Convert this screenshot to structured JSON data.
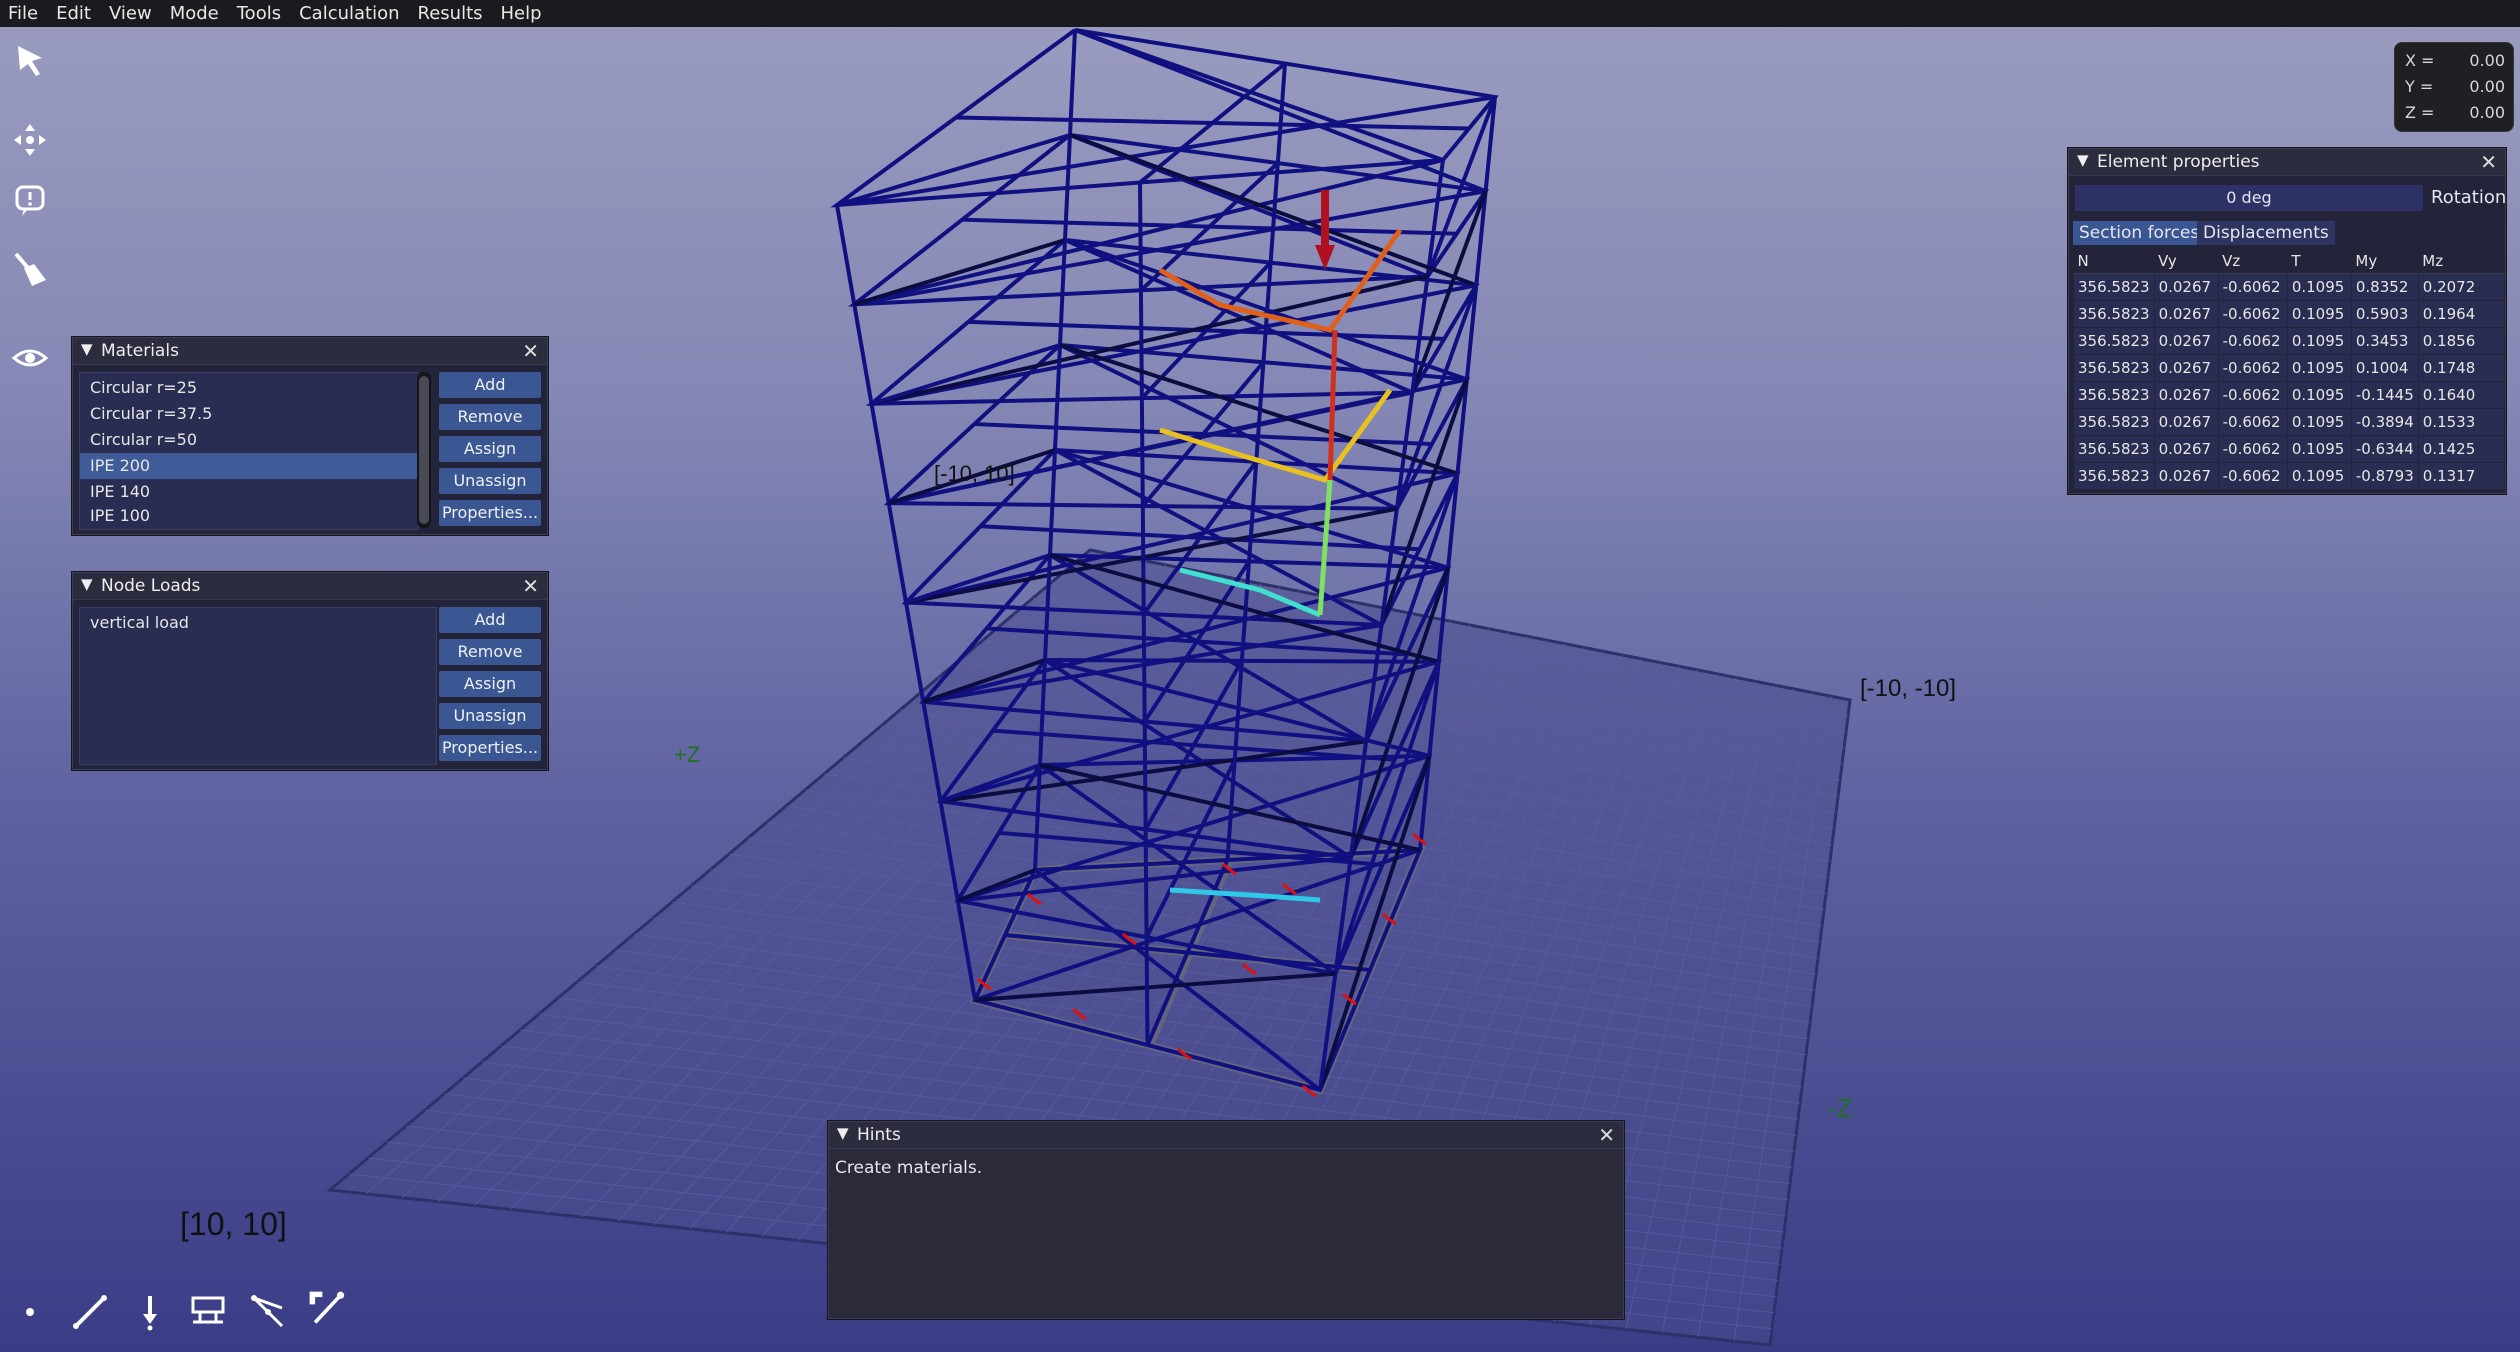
{
  "menu": [
    "File",
    "Edit",
    "View",
    "Mode",
    "Tools",
    "Calculation",
    "Results",
    "Help"
  ],
  "coords": {
    "x_label": "X =",
    "y_label": "Y =",
    "z_label": "Z =",
    "x": "0.00",
    "y": "0.00",
    "z": "0.00"
  },
  "viewport": {
    "corner_a": "[-10, 10]",
    "corner_b": "[-10, -10]",
    "corner_c": "[10, 10]",
    "axis_pos": "+Z",
    "axis_neg": "-Z"
  },
  "materials": {
    "title": "Materials",
    "items": [
      "Circular r=25",
      "Circular r=37.5",
      "Circular r=50",
      "IPE 200",
      "IPE 140",
      "IPE 100"
    ],
    "selected_index": 3,
    "buttons": {
      "add": "Add",
      "remove": "Remove",
      "assign": "Assign",
      "unassign": "Unassign",
      "properties": "Properties..."
    }
  },
  "node_loads": {
    "title": "Node Loads",
    "items": [
      "vertical load"
    ],
    "buttons": {
      "add": "Add",
      "remove": "Remove",
      "assign": "Assign",
      "unassign": "Unassign",
      "properties": "Properties..."
    }
  },
  "element_properties": {
    "title": "Element properties",
    "rotation_value": "0 deg",
    "rotation_label": "Rotation",
    "tabs": [
      "Section forces",
      "Displacements"
    ],
    "columns": [
      "N",
      "Vy",
      "Vz",
      "T",
      "My",
      "Mz"
    ],
    "rows": [
      [
        "356.5823",
        "0.0267",
        "-0.6062",
        "0.1095",
        "0.8352",
        "0.2072"
      ],
      [
        "356.5823",
        "0.0267",
        "-0.6062",
        "0.1095",
        "0.5903",
        "0.1964"
      ],
      [
        "356.5823",
        "0.0267",
        "-0.6062",
        "0.1095",
        "0.3453",
        "0.1856"
      ],
      [
        "356.5823",
        "0.0267",
        "-0.6062",
        "0.1095",
        "0.1004",
        "0.1748"
      ],
      [
        "356.5823",
        "0.0267",
        "-0.6062",
        "0.1095",
        "-0.1445",
        "0.1640"
      ],
      [
        "356.5823",
        "0.0267",
        "-0.6062",
        "0.1095",
        "-0.3894",
        "0.1533"
      ],
      [
        "356.5823",
        "0.0267",
        "-0.6062",
        "0.1095",
        "-0.6344",
        "0.1425"
      ],
      [
        "356.5823",
        "0.0267",
        "-0.6062",
        "0.1095",
        "-0.8793",
        "0.1317"
      ]
    ]
  },
  "hints": {
    "title": "Hints",
    "text": "Create materials."
  },
  "icons": {
    "left_toolbar": [
      "select-arrow-icon",
      "move-icon",
      "info-icon",
      "clean-brush-icon",
      "view-eye-icon"
    ],
    "bottom_toolbar": [
      "node-icon",
      "line-element-icon",
      "load-icon",
      "support-icon",
      "split-icon",
      "edit-element-icon"
    ]
  }
}
